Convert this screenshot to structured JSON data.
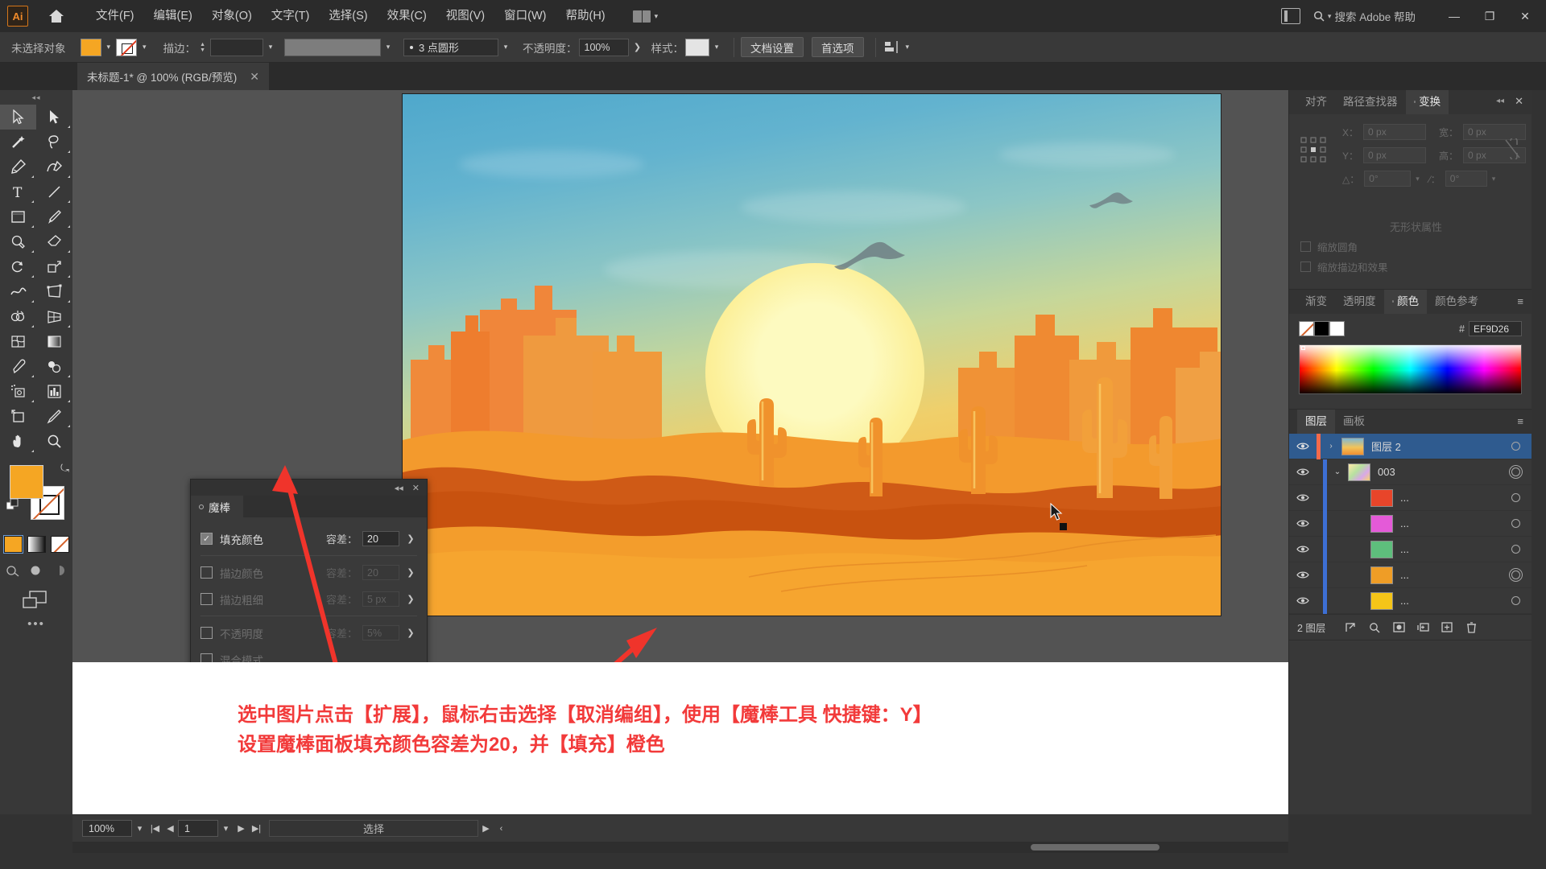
{
  "app": {
    "logo": "Ai",
    "home_icon": "home-icon"
  },
  "menubar": {
    "items": [
      {
        "label": "文件(F)"
      },
      {
        "label": "编辑(E)"
      },
      {
        "label": "对象(O)"
      },
      {
        "label": "文字(T)"
      },
      {
        "label": "选择(S)"
      },
      {
        "label": "效果(C)"
      },
      {
        "label": "视图(V)"
      },
      {
        "label": "窗口(W)"
      },
      {
        "label": "帮助(H)"
      }
    ],
    "search_placeholder": "搜索 Adobe 帮助",
    "minimize": "—",
    "maximize": "❐",
    "close": "✕"
  },
  "controlbar": {
    "selection_status": "未选择对象",
    "fill_color": "#F5A623",
    "stroke_label": "描边：",
    "stroke_weight": "",
    "brush_label": "3 点圆形",
    "opacity_label": "不透明度：",
    "opacity_value": "100%",
    "style_label": "样式：",
    "doc_setup_button": "文档设置",
    "preferences_button": "首选项"
  },
  "document_tab": {
    "title": "未标题-1* @ 100% (RGB/预览)",
    "close": "✕"
  },
  "toolbar": {
    "tools": [
      {
        "name": "selection-tool",
        "glyph": "selection",
        "active": true
      },
      {
        "name": "direct-selection-tool",
        "glyph": "direct-selection"
      },
      {
        "name": "magic-wand-tool",
        "glyph": "magic-wand"
      },
      {
        "name": "lasso-tool",
        "glyph": "lasso"
      },
      {
        "name": "pen-tool",
        "glyph": "pen"
      },
      {
        "name": "curvature-tool",
        "glyph": "curvature"
      },
      {
        "name": "type-tool",
        "glyph": "type"
      },
      {
        "name": "line-segment-tool",
        "glyph": "line"
      },
      {
        "name": "rectangle-tool",
        "glyph": "rectangle"
      },
      {
        "name": "paintbrush-tool",
        "glyph": "paintbrush"
      },
      {
        "name": "shaper-tool",
        "glyph": "shaper"
      },
      {
        "name": "eraser-tool",
        "glyph": "eraser"
      },
      {
        "name": "rotate-tool",
        "glyph": "rotate"
      },
      {
        "name": "scale-tool",
        "glyph": "scale"
      },
      {
        "name": "width-tool",
        "glyph": "width"
      },
      {
        "name": "free-transform-tool",
        "glyph": "free-transform"
      },
      {
        "name": "shape-builder-tool",
        "glyph": "shape-builder"
      },
      {
        "name": "perspective-grid-tool",
        "glyph": "perspective"
      },
      {
        "name": "mesh-tool",
        "glyph": "mesh"
      },
      {
        "name": "gradient-tool",
        "glyph": "gradient"
      },
      {
        "name": "eyedropper-tool",
        "glyph": "eyedropper"
      },
      {
        "name": "blend-tool",
        "glyph": "blend"
      },
      {
        "name": "symbol-sprayer-tool",
        "glyph": "symbol-sprayer"
      },
      {
        "name": "column-graph-tool",
        "glyph": "graph"
      },
      {
        "name": "artboard-tool",
        "glyph": "artboard"
      },
      {
        "name": "slice-tool",
        "glyph": "slice"
      },
      {
        "name": "hand-tool",
        "glyph": "hand"
      },
      {
        "name": "zoom-tool",
        "glyph": "zoom"
      }
    ],
    "fill_color": "#F5A623",
    "stroke_color": "none",
    "more_tools": "•••"
  },
  "magic_wand_panel": {
    "title": "魔棒",
    "collapse": "◂◂",
    "close": "✕",
    "rows": [
      {
        "label": "填充颜色",
        "checked": true,
        "tolerance_label": "容差：",
        "tolerance_value": "20",
        "enabled": true
      },
      {
        "label": "描边颜色",
        "checked": false,
        "tolerance_label": "容差：",
        "tolerance_value": "20",
        "enabled": false
      },
      {
        "label": "描边粗细",
        "checked": false,
        "tolerance_label": "容差：",
        "tolerance_value": "5 px",
        "enabled": false
      },
      {
        "label": "不透明度",
        "checked": false,
        "tolerance_label": "容差：",
        "tolerance_value": "5%",
        "enabled": false
      },
      {
        "label": "混合模式",
        "checked": false,
        "tolerance_label": "",
        "tolerance_value": "",
        "enabled": false
      }
    ]
  },
  "caption": {
    "line1": "选中图片点击【扩展】，鼠标右击选择【取消编组】，使用【魔棒工具 快捷键：Y】",
    "line2": "设置魔棒面板填充颜色容差为20，并【填充】橙色",
    "color": "#F23A3A"
  },
  "statusbar": {
    "zoom": "100%",
    "page": "1",
    "tool_name": "选择",
    "first": "|◀",
    "prev": "◀",
    "next": "▶",
    "last": "▶|",
    "expand": "▶",
    "collapse": "‹"
  },
  "dock": {
    "transform_panel": {
      "tabs": [
        {
          "label": "对齐",
          "active": false
        },
        {
          "label": "路径查找器",
          "active": false
        },
        {
          "label": "变换",
          "active": true
        }
      ],
      "menu_icon": "panel-menu-icon",
      "close": "✕",
      "fields": [
        {
          "label": "X：",
          "value": "0 px"
        },
        {
          "label": "宽：",
          "value": "0 px"
        },
        {
          "label": "Y：",
          "value": "0 px"
        },
        {
          "label": "高：",
          "value": "0 px"
        }
      ],
      "angle_label": "△：",
      "angle_value": "0°",
      "shear_label": "⁄：",
      "shear_value": "0°",
      "checkbox1": "缩放圆角",
      "checkbox2": "缩放描边和效果",
      "empty_text": "无形状属性"
    },
    "color_panel": {
      "tabs": [
        {
          "label": "渐变",
          "active": false
        },
        {
          "label": "透明度",
          "active": false
        },
        {
          "label": "颜色",
          "active": true
        },
        {
          "label": "颜色参考",
          "active": false
        }
      ],
      "menu_icon": "panel-menu-icon",
      "hex_symbol": "#",
      "hex_value": "EF9D26"
    },
    "layers_panel": {
      "tabs": [
        {
          "label": "图层",
          "active": true
        },
        {
          "label": "画板",
          "active": false
        }
      ],
      "menu_icon": "panel-menu-icon",
      "rows": [
        {
          "name": "图层 2",
          "selected": true,
          "indent": 0,
          "color": "#F36A4B",
          "thumb": "artwork",
          "expander": "›",
          "eye": "visible",
          "target": "○"
        },
        {
          "name": "003",
          "selected": false,
          "indent": 1,
          "color": "#3D6FD4",
          "thumb": "group",
          "expander": "⌄",
          "eye": "visible",
          "target": "◎"
        },
        {
          "name": "...",
          "selected": false,
          "indent": 2,
          "color": "#3D6FD4",
          "thumb": "#E8452A",
          "expander": "",
          "eye": "visible",
          "target": "○"
        },
        {
          "name": "...",
          "selected": false,
          "indent": 2,
          "color": "#3D6FD4",
          "thumb": "#E45AD8",
          "expander": "",
          "eye": "visible",
          "target": "○"
        },
        {
          "name": "...",
          "selected": false,
          "indent": 2,
          "color": "#3D6FD4",
          "thumb": "#5EBE7C",
          "expander": "",
          "eye": "visible",
          "target": "○"
        },
        {
          "name": "...",
          "selected": false,
          "indent": 2,
          "color": "#3D6FD4",
          "thumb": "#EF9D26",
          "expander": "",
          "eye": "visible",
          "target": "◎"
        },
        {
          "name": "...",
          "selected": false,
          "indent": 2,
          "color": "#3D6FD4",
          "thumb": "#F5C518",
          "expander": "",
          "eye": "visible",
          "target": "○"
        }
      ],
      "footer_count": "2 图层",
      "footer_icons": [
        "locate-object-icon",
        "search-icon",
        "make-mask-icon",
        "new-sublayer-icon",
        "new-layer-icon",
        "delete-layer-icon"
      ]
    }
  },
  "illustration": {
    "alt": "desert sunset with cacti and mesas",
    "sky_top": "#4FA8CC",
    "sun_color": "#FDFAC0",
    "sand_color": "#F5A22E",
    "mesa_color": "#E8601C"
  }
}
